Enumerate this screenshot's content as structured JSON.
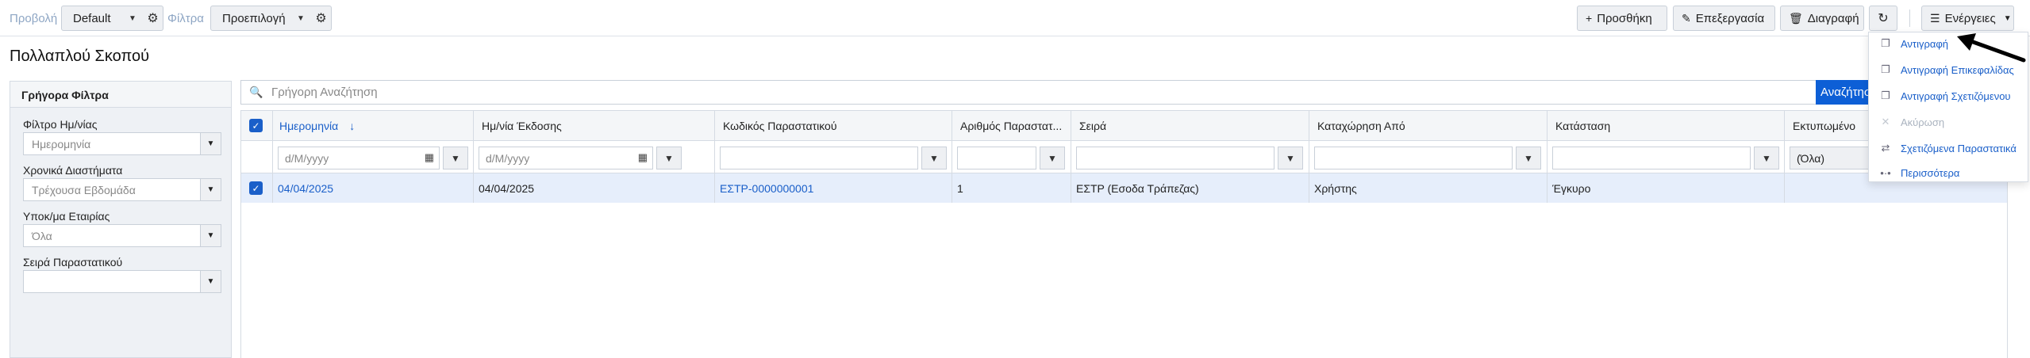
{
  "toolbar": {
    "view_label": "Προβολή",
    "view_value": "Default",
    "filter_label": "Φίλτρα",
    "filter_value": "Προεπιλογή",
    "add_label": "Προσθήκη",
    "edit_label": "Επεξεργασία",
    "delete_label": "Διαγραφή",
    "actions_label": "Ενέργειες"
  },
  "page": {
    "title": "Πολλαπλού Σκοπού"
  },
  "quick_filters": {
    "title": "Γρήγορα Φίλτρα",
    "items": [
      {
        "label": "Φίλτρο Ημ/νίας",
        "value": "Ημερομηνία"
      },
      {
        "label": "Χρονικά Διαστήματα",
        "value": "Τρέχουσα Εβδομάδα"
      },
      {
        "label": "Υποκ/μα Εταιρίας",
        "value": "Όλα"
      },
      {
        "label": "Σειρά Παραστατικού",
        "value": ""
      }
    ]
  },
  "search": {
    "placeholder": "Γρήγορη Αναζήτηση",
    "button_label": "Αναζήτηση"
  },
  "grid": {
    "columns": [
      "Ημερομηνία",
      "Ημ/νία Έκδοσης",
      "Κωδικός Παραστατικού",
      "Αριθμός Παραστατ...",
      "Σειρά",
      "Καταχώρηση Από",
      "Κατάσταση",
      "Εκτυπωμένο"
    ],
    "sort_indicator": "↓",
    "filter_placeholders": {
      "date": "d/M/yyyy",
      "printed": "(Όλα)"
    },
    "rows": [
      {
        "date": "04/04/2025",
        "issue_date": "04/04/2025",
        "code": "ΕΣΤΡ-0000000001",
        "number": "1",
        "series": "ΕΣΤΡ (Εσοδα Τράπεζας)",
        "created_by": "Χρήστης",
        "status": "Έγκυρο",
        "printed": ""
      }
    ]
  },
  "actions_menu": {
    "items": [
      {
        "label": "Αντιγραφή",
        "icon": "copy-icon",
        "enabled": true
      },
      {
        "label": "Αντιγραφή Επικεφαλίδας",
        "icon": "copy-icon",
        "enabled": true
      },
      {
        "label": "Αντιγραφή Σχετιζόμενου",
        "icon": "copy-icon",
        "enabled": true
      },
      {
        "label": "Ακύρωση",
        "icon": "close-icon",
        "enabled": false
      },
      {
        "label": "Σχετιζόμενα Παραστατικά",
        "icon": "exchange-icon",
        "enabled": true
      },
      {
        "label": "Περισσότερα",
        "icon": "more-icon",
        "enabled": true
      }
    ]
  },
  "colors": {
    "accent": "#1a5fc9",
    "search_button": "#0d5fd6",
    "selected_row": "#e6eefb"
  }
}
